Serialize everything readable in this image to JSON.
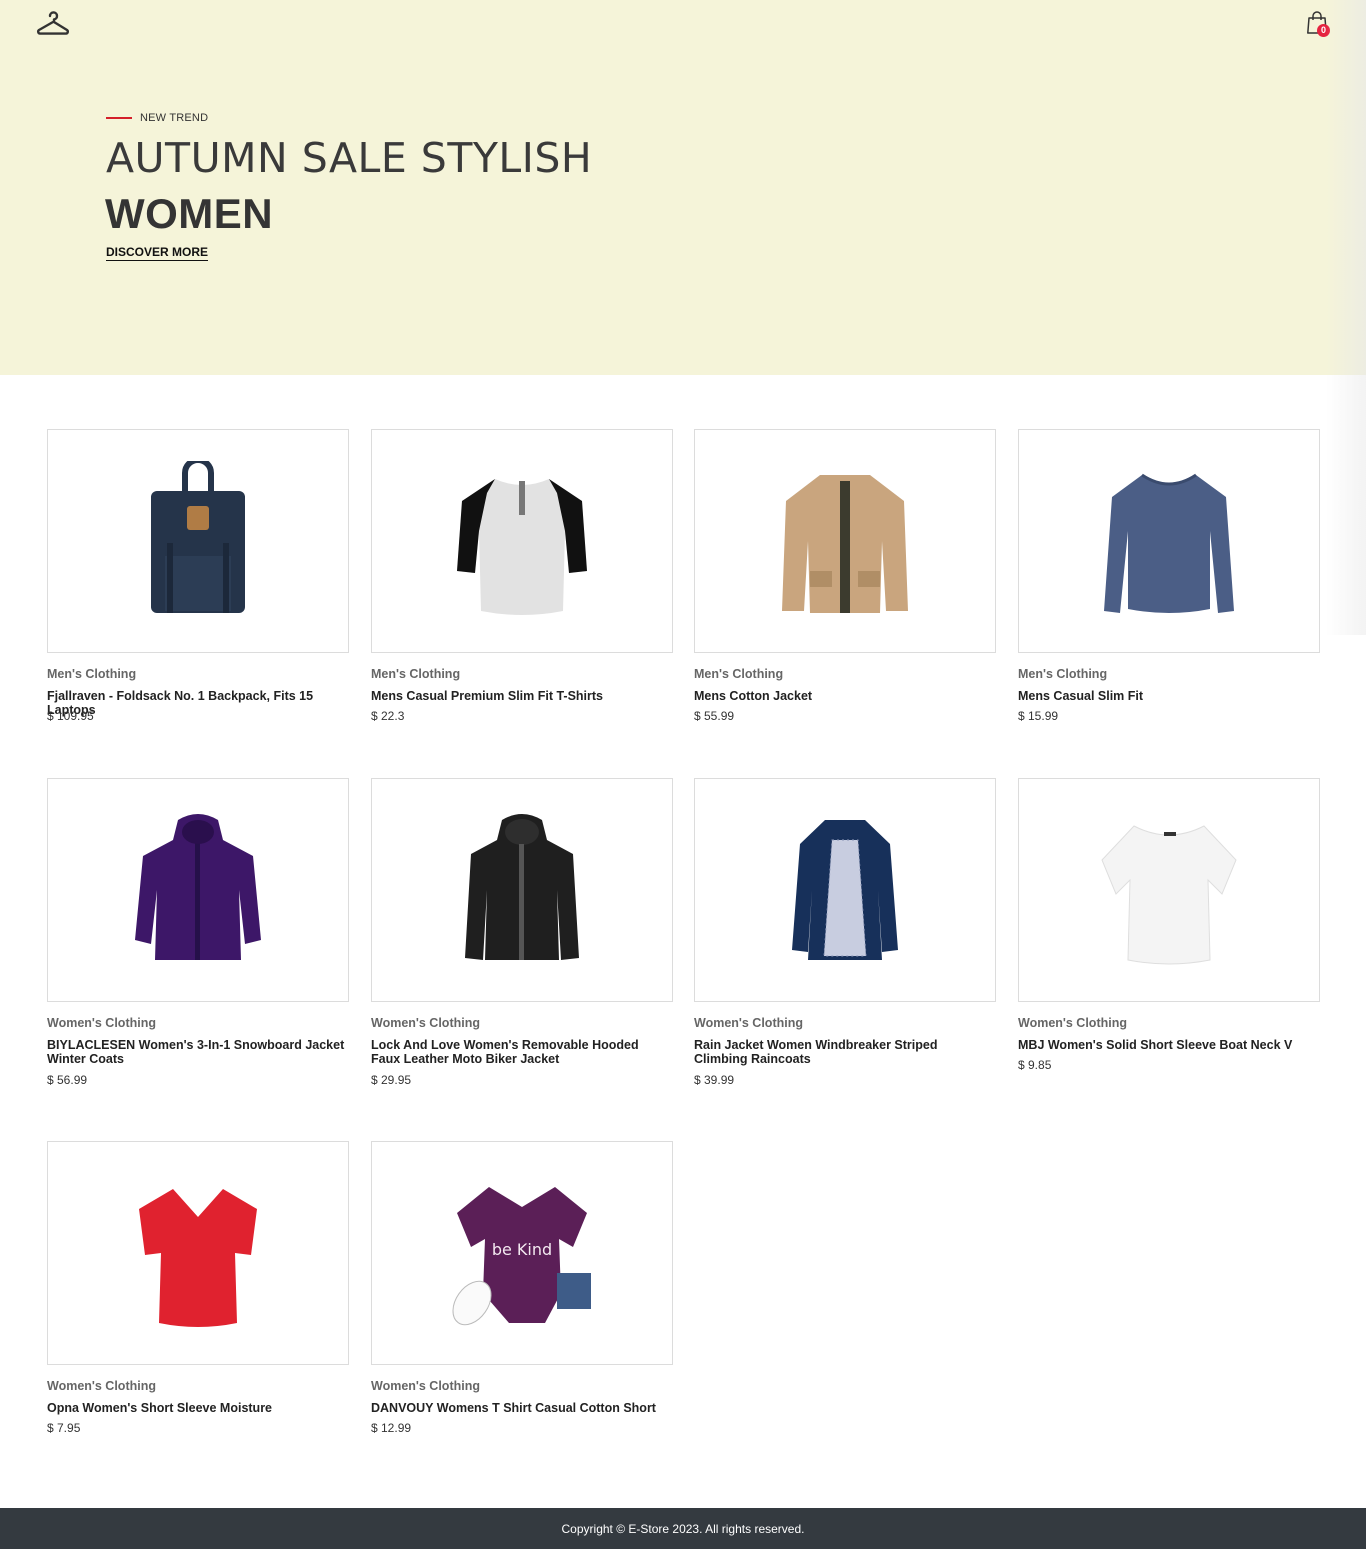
{
  "header": {
    "logo_icon": "hanger-icon",
    "cart_icon": "shopping-bag-icon",
    "cart_count": "0"
  },
  "hero": {
    "tag": "NEW TREND",
    "title": "AUTUMN SALE STYLISH",
    "subtitle": "WOMEN",
    "cta": "DISCOVER MORE"
  },
  "products": [
    {
      "category": "Men's Clothing",
      "name": "Fjallraven - Foldsack No. 1 Backpack, Fits 15 Laptops",
      "price": "$ 109.95",
      "icon": "backpack-image"
    },
    {
      "category": "Men's Clothing",
      "name": "Mens Casual Premium Slim Fit T-Shirts",
      "price": "$ 22.3",
      "icon": "raglan-tshirt-image"
    },
    {
      "category": "Men's Clothing",
      "name": "Mens Cotton Jacket",
      "price": "$ 55.99",
      "icon": "cotton-jacket-image"
    },
    {
      "category": "Men's Clothing",
      "name": "Mens Casual Slim Fit",
      "price": "$ 15.99",
      "icon": "long-sleeve-shirt-image"
    },
    {
      "category": "Women's Clothing",
      "name": "BIYLACLESEN Women's 3-In-1 Snowboard Jacket Winter Coats",
      "price": "$ 56.99",
      "icon": "snowboard-jacket-image"
    },
    {
      "category": "Women's Clothing",
      "name": "Lock And Love Women's Removable Hooded Faux Leather Moto Biker Jacket",
      "price": "$ 29.95",
      "icon": "leather-jacket-image"
    },
    {
      "category": "Women's Clothing",
      "name": "Rain Jacket Women Windbreaker Striped Climbing Raincoats",
      "price": "$ 39.99",
      "icon": "rain-jacket-image"
    },
    {
      "category": "Women's Clothing",
      "name": "MBJ Women's Solid Short Sleeve Boat Neck V",
      "price": "$ 9.85",
      "icon": "white-top-image"
    },
    {
      "category": "Women's Clothing",
      "name": "Opna Women's Short Sleeve Moisture",
      "price": "$ 7.95",
      "icon": "red-tshirt-image"
    },
    {
      "category": "Women's Clothing",
      "name": "DANVOUY Womens T Shirt Casual Cotton Short",
      "price": "$ 12.99",
      "icon": "purple-tshirt-image",
      "print_text": "be Kind"
    }
  ],
  "footer": {
    "copyright": "Copyright © E-Store 2023. All rights reserved."
  },
  "colors": {
    "hero_bg": "#f5f4d9",
    "accent_red": "#d4202a",
    "badge": "#e5233f",
    "footer_bg": "#343a40"
  }
}
